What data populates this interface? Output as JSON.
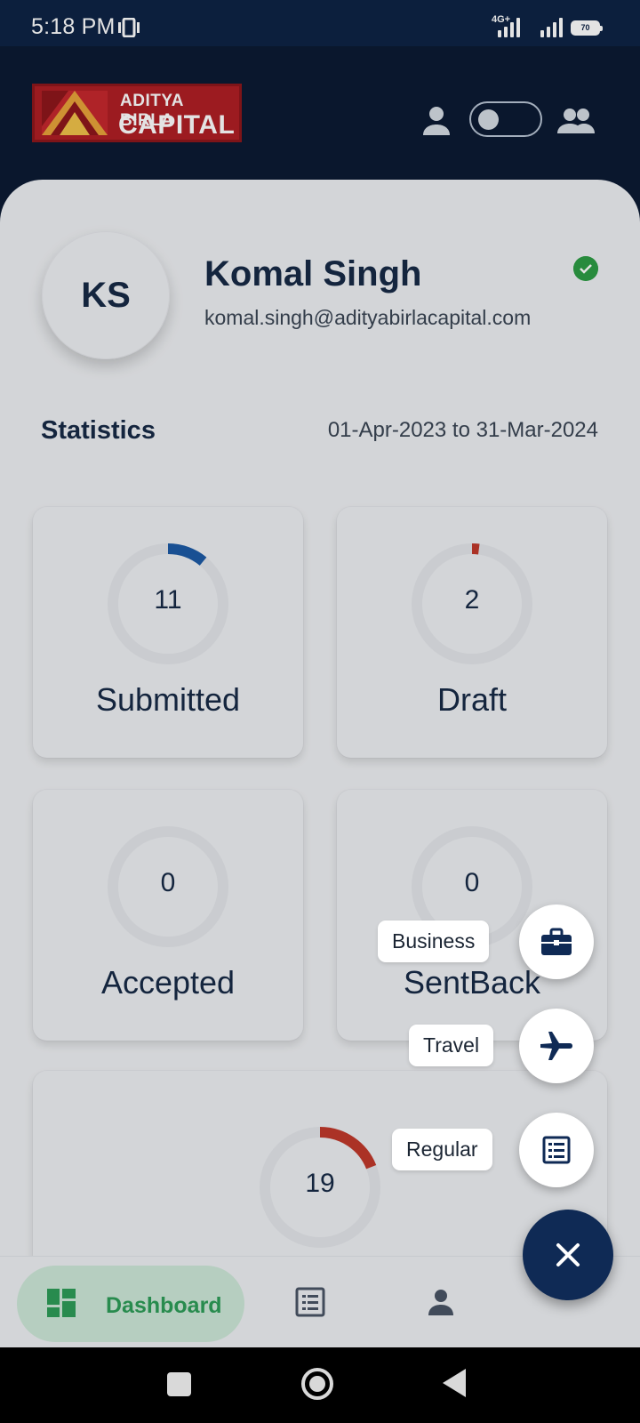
{
  "status_bar": {
    "time": "5:18 PM",
    "network": "4G+",
    "battery": "70"
  },
  "header": {
    "logo": {
      "line1": "ADITYA BIRLA",
      "line2": "CAPITAL"
    },
    "icons": [
      "person-icon",
      "toggle-switch",
      "group-icon"
    ]
  },
  "profile": {
    "initials": "KS",
    "name": "Komal Singh",
    "email": "komal.singh@adityabirlacapital.com",
    "verified": true
  },
  "statistics": {
    "title": "Statistics",
    "range": "01-Apr-2023 to 31-Mar-2024",
    "cards": [
      {
        "label": "Submitted",
        "count": "11",
        "ring_fraction": 0.11,
        "color": "#1d5aa6"
      },
      {
        "label": "Draft",
        "count": "2",
        "ring_fraction": 0.02,
        "color": "#c0392b"
      },
      {
        "label": "Accepted",
        "count": "0",
        "ring_fraction": 0,
        "color": "#2e9d45"
      },
      {
        "label": "SentBack",
        "count": "0",
        "ring_fraction": 0,
        "color": "#e08a1e"
      }
    ],
    "total": {
      "count": "19",
      "ring_fraction": 0.19,
      "color": "#c0392b"
    }
  },
  "fab_menu": {
    "items": [
      {
        "label": "Business",
        "icon": "briefcase-icon"
      },
      {
        "label": "Travel",
        "icon": "airplane-icon"
      },
      {
        "label": "Regular",
        "icon": "list-icon"
      }
    ],
    "close_icon": "close-icon"
  },
  "bottom_nav": {
    "items": [
      {
        "label": "Dashboard",
        "icon": "dashboard-icon",
        "active": true
      },
      {
        "label": "",
        "icon": "list-icon",
        "active": false
      },
      {
        "label": "",
        "icon": "person-icon",
        "active": false
      }
    ]
  },
  "colors": {
    "header_bg": "#0c1a33",
    "accent_green": "#2e9d58",
    "fab_bg": "#0f2a55",
    "brand_red": "#b01f24"
  }
}
